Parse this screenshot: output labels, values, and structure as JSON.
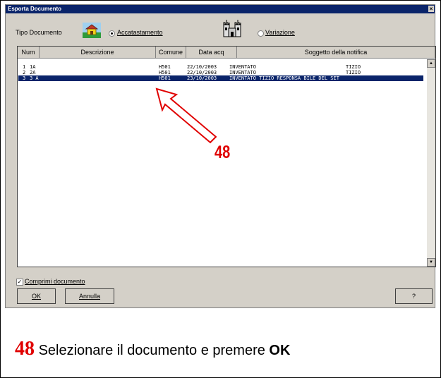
{
  "window": {
    "title": "Esporta Documento",
    "close_label": "×"
  },
  "tipo_documento": {
    "label": "Tipo Documento",
    "option_accatastamento": {
      "label": "Accatastamento",
      "selected": true
    },
    "option_variazione": {
      "label": "Variazione",
      "selected": false
    }
  },
  "table": {
    "columns": [
      "Num",
      "Descrizione",
      "Comune",
      "Data acq",
      "Soggetto della notifica"
    ],
    "rows": [
      {
        "num": "1",
        "descrizione": "1A",
        "comune": "H501",
        "data_acq": "22/10/2003",
        "soggetto": "INVENTATO",
        "soggetto2": "TIZIO",
        "selected": false
      },
      {
        "num": "2",
        "descrizione": "2A",
        "comune": "H501",
        "data_acq": "22/10/2003",
        "soggetto": "INVENTATO",
        "soggetto2": "TIZIO",
        "selected": false
      },
      {
        "num": "3",
        "descrizione": "3 A",
        "comune": "H501",
        "data_acq": "23/10/2003",
        "soggetto": "INVENTATO TIZIO RESPONSA BILE DEL SET",
        "soggetto2": "",
        "selected": true
      }
    ]
  },
  "comprimi": {
    "label": "Comprimi documento",
    "checked": true
  },
  "buttons": {
    "ok": "OK",
    "annulla": "Annulla",
    "help": "?"
  },
  "annotation": {
    "number": "48",
    "color": "#e00000"
  },
  "caption": {
    "number": "48",
    "text": "Selezionare il documento e premere",
    "bold": "OK"
  }
}
